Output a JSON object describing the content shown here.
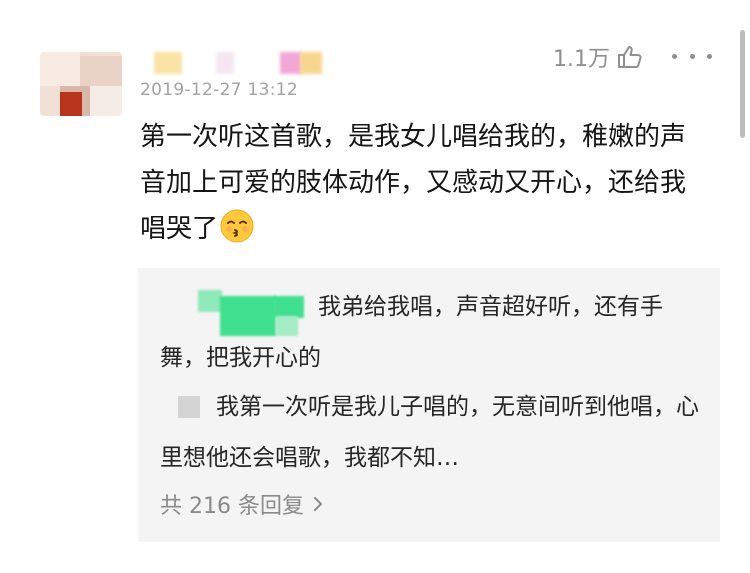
{
  "comment": {
    "timestamp": "2019-12-27 13:12",
    "likes": "1.1万",
    "text": "第一次听这首歌，是我女儿唱给我的，稚嫩的声音加上可爱的肢体动作，又感动又开心，还给我唱哭了",
    "emoji": "kissing-face-smiling-eyes"
  },
  "replies": [
    {
      "text": "我弟给我唱，声音超好听，还有手舞，把我开心的"
    },
    {
      "text": "我第一次听是我儿子唱的，无意间听到他唱，心里想他还会唱歌，我都不知…"
    }
  ],
  "reply_summary": "共 216 条回复",
  "icons": {
    "like": "thumbs-up-icon",
    "more": "more-dots-icon",
    "expand": "chevron-right-icon"
  },
  "colors": {
    "reply_bg": "#f4f4f4",
    "meta_text": "#a2a2a2",
    "blur_green": "#3fe08e"
  }
}
